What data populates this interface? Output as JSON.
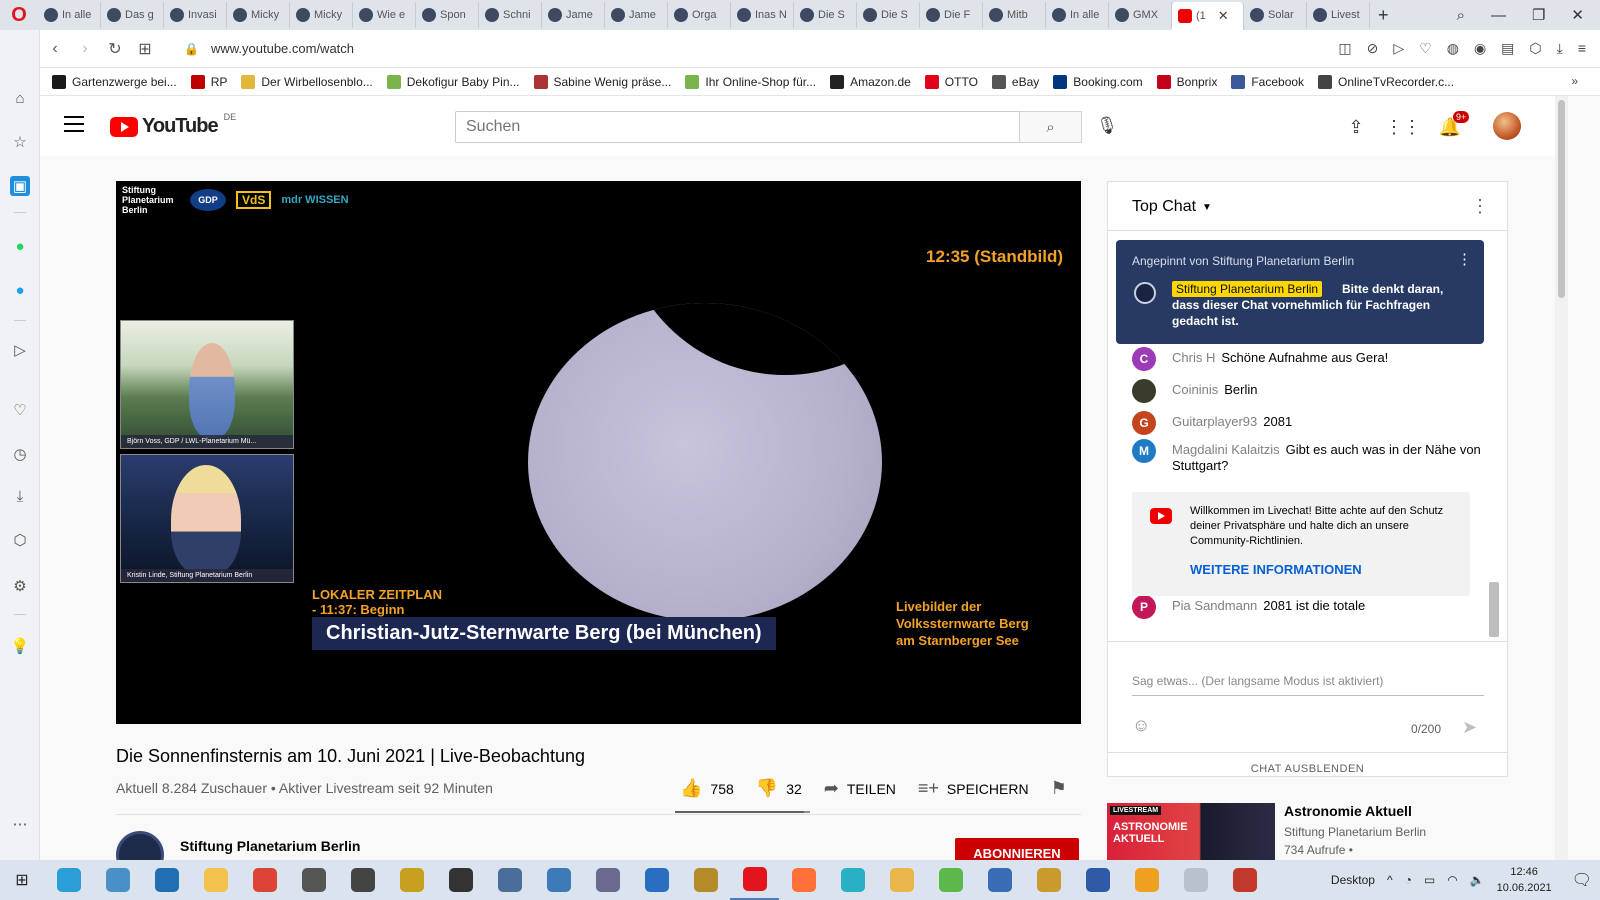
{
  "browser": {
    "tabs": [
      {
        "label": "In alle",
        "active": false
      },
      {
        "label": "Das g",
        "active": false
      },
      {
        "label": "Invasi",
        "active": false
      },
      {
        "label": "Micky",
        "active": false
      },
      {
        "label": "Micky",
        "active": false
      },
      {
        "label": "Wie e",
        "active": false
      },
      {
        "label": "Spon",
        "active": false
      },
      {
        "label": "Schni",
        "active": false
      },
      {
        "label": "Jame",
        "active": false
      },
      {
        "label": "Jame",
        "active": false
      },
      {
        "label": "Orga",
        "active": false
      },
      {
        "label": "Inas N",
        "active": false
      },
      {
        "label": "Die S",
        "active": false
      },
      {
        "label": "Die S",
        "active": false
      },
      {
        "label": "Die F",
        "active": false
      },
      {
        "label": "Mitb",
        "active": false
      },
      {
        "label": "In alle",
        "active": false
      },
      {
        "label": "GMX",
        "active": false
      },
      {
        "label": "(1",
        "active": true
      },
      {
        "label": "Solar",
        "active": false
      },
      {
        "label": "Livest",
        "active": false
      }
    ],
    "url": "www.youtube.com/watch",
    "bookmarks": [
      {
        "label": "Gartenzwerge bei...",
        "color": "#1a1a1a"
      },
      {
        "label": "RP",
        "color": "#c00000"
      },
      {
        "label": "Der Wirbellosenblo...",
        "color": "#e2b53c"
      },
      {
        "label": "Dekofigur Baby Pin...",
        "color": "#7ab44a"
      },
      {
        "label": "Sabine Wenig präse...",
        "color": "#a33"
      },
      {
        "label": "Ihr Online-Shop für...",
        "color": "#7ab44a"
      },
      {
        "label": "Amazon.de",
        "color": "#222"
      },
      {
        "label": "OTTO",
        "color": "#e2001a"
      },
      {
        "label": "eBay",
        "color": "#555"
      },
      {
        "label": "Booking.com",
        "color": "#003580"
      },
      {
        "label": "Bonprix",
        "color": "#c4001a"
      },
      {
        "label": "Facebook",
        "color": "#3b5998"
      },
      {
        "label": "OnlineTvRecorder.c...",
        "color": "#444"
      }
    ]
  },
  "youtube": {
    "logo_text": "YouTube",
    "country": "DE",
    "search_placeholder": "Suchen",
    "notification_count": "9+"
  },
  "player": {
    "org_label": "Stiftung Planetarium Berlin",
    "logo_gdp": "GDP",
    "logo_vds": "VdS",
    "logo_mdr": "mdr WISSEN",
    "time_overlay": "12:35 (Standbild)",
    "pip_1_caption": "Björn Voss, GDP / LWL-Planetarium Mü...",
    "pip_2_caption": "Kristin Linde, Stiftung Planetarium Berlin",
    "schedule_title": "LOKALER ZEITPLAN",
    "schedule_line": "- 11:37: Beginn",
    "location": "Christian-Jutz-Sternwarte Berg (bei München)",
    "live_note_1": "Livebilder der",
    "live_note_2": "Volkssternwarte Berg",
    "live_note_3": "am Starnberger See"
  },
  "video": {
    "title": "Die Sonnenfinsternis am 10. Juni 2021 | Live-Beobachtung",
    "meta": "Aktuell 8.284 Zuschauer • Aktiver Livestream seit 92 Minuten",
    "likes": "758",
    "dislikes": "32",
    "like_ratio": 0.959,
    "share_label": "TEILEN",
    "save_label": "SPEICHERN",
    "channel_name": "Stiftung Planetarium Berlin",
    "subscribe_label": "ABONNIEREN"
  },
  "chat": {
    "mode_label": "Top Chat",
    "pinned_label": "Angepinnt von Stiftung Planetarium Berlin",
    "pinned_author": "Stiftung Planetarium Berlin",
    "pinned_text": "Bitte denkt daran, dass dieser Chat vornehmlich für Fachfragen gedacht ist.",
    "messages": [
      {
        "initial": "C",
        "color": "#9c3ab7",
        "author": "Chris H",
        "text": "Schöne Aufnahme aus Gera!"
      },
      {
        "initial": "",
        "color": "#3b3b2b",
        "author": "Coininis",
        "text": "Berlin"
      },
      {
        "initial": "G",
        "color": "#c4451c",
        "author": "Guitarplayer93",
        "text": "2081"
      },
      {
        "initial": "M",
        "color": "#1f7bc6",
        "author": "Magdalini Kalaitzis",
        "text": "Gibt es auch was in der Nähe von Stuttgart?"
      },
      {
        "initial": "P",
        "color": "#c2185b",
        "author": "Pia Sandmann",
        "text": "2081 ist die totale"
      }
    ],
    "welcome_text": "Willkommen im Livechat! Bitte achte auf den Schutz deiner Privatsphäre und halte dich an unsere Community-Richtlinien.",
    "welcome_link": "WEITERE INFORMATIONEN",
    "input_placeholder": "Sag etwas... (Der langsame Modus ist aktiviert)",
    "char_count": "0/200",
    "hide_chat": "CHAT AUSBLENDEN"
  },
  "recommendation": {
    "thumb_badge": "LIVESTREAM",
    "thumb_title": "ASTRONOMIE AKTUELL",
    "title": "Astronomie Aktuell",
    "channel": "Stiftung Planetarium Berlin",
    "views": "734 Aufrufe •"
  },
  "taskbar": {
    "apps": [
      {
        "name": "edge",
        "color": "#2a9fd6"
      },
      {
        "name": "store",
        "color": "#4a90c8"
      },
      {
        "name": "edge-legacy",
        "color": "#1f6fb2"
      },
      {
        "name": "explorer",
        "color": "#f2c14e"
      },
      {
        "name": "chrome",
        "color": "#db4437"
      },
      {
        "name": "app-s",
        "color": "#555"
      },
      {
        "name": "settings",
        "color": "#444"
      },
      {
        "name": "app-8",
        "color": "#c8a020"
      },
      {
        "name": "app-9",
        "color": "#333"
      },
      {
        "name": "app-10",
        "color": "#4b6d9c"
      },
      {
        "name": "app-11",
        "color": "#3d7ab8"
      },
      {
        "name": "app-12",
        "color": "#6a6a90"
      },
      {
        "name": "app-13",
        "color": "#2a6ec1"
      },
      {
        "name": "app-14",
        "color": "#b58b2a"
      },
      {
        "name": "opera",
        "color": "#e3141d"
      },
      {
        "name": "firefox",
        "color": "#ff7139"
      },
      {
        "name": "app-17",
        "color": "#2ab0c6"
      },
      {
        "name": "app-18",
        "color": "#e8b64a"
      },
      {
        "name": "app-19",
        "color": "#5cb84a"
      },
      {
        "name": "app-20",
        "color": "#3a6bb5"
      },
      {
        "name": "app-21",
        "color": "#c99a2e"
      },
      {
        "name": "defender",
        "color": "#2f5aa8"
      },
      {
        "name": "app-23",
        "color": "#f0a020"
      },
      {
        "name": "app-24",
        "color": "#b8c2cc"
      },
      {
        "name": "app-25",
        "color": "#c0392b"
      }
    ],
    "desktop_label": "Desktop",
    "time": "12:46",
    "date": "10.06.2021"
  }
}
